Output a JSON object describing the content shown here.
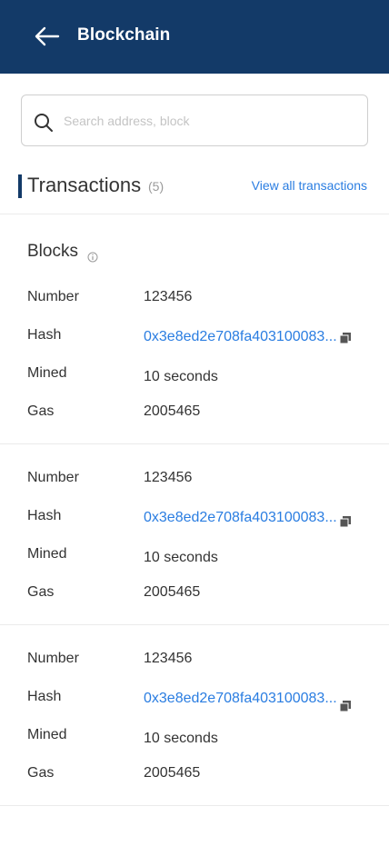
{
  "app_bar": {
    "title": "Blockchain",
    "back_icon": "arrow-left-icon",
    "background": "#133a68"
  },
  "search": {
    "placeholder": "Search address, block",
    "value": "",
    "icon": "search-icon"
  },
  "transactions": {
    "title": "Transactions",
    "count": "(5)",
    "view_all_label": "View all transactions"
  },
  "blocks": {
    "title": "Blocks",
    "info_icon": "info-icon",
    "labels": {
      "number": "Number",
      "hash": "Hash",
      "mined": "Mined",
      "gas": "Gas"
    },
    "items": [
      {
        "number": "123456",
        "hash": "0x3e8ed2e708fa403100083...",
        "mined": "10 seconds",
        "gas": "2005465"
      },
      {
        "number": "123456",
        "hash": "0x3e8ed2e708fa403100083...",
        "mined": "10 seconds",
        "gas": "2005465"
      },
      {
        "number": "123456",
        "hash": "0x3e8ed2e708fa403100083...",
        "mined": "10 seconds",
        "gas": "2005465"
      }
    ]
  },
  "colors": {
    "accent": "#2a7de1",
    "primary": "#133a68"
  }
}
